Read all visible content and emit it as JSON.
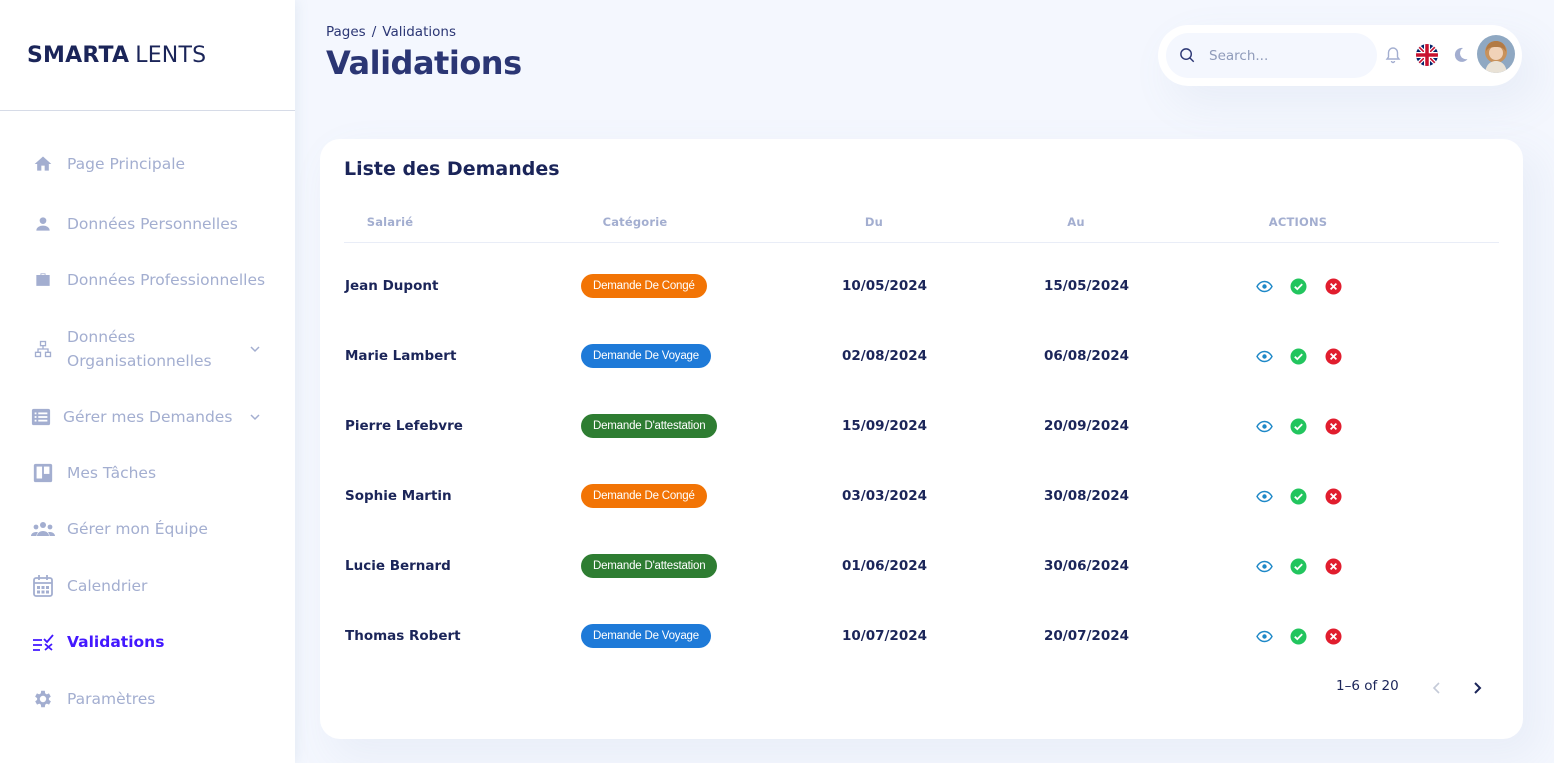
{
  "brand": {
    "bold": "SMARTA",
    "light": "LENTS"
  },
  "sidebar": {
    "items": [
      {
        "label": "Page Principale",
        "icon": "home-icon"
      },
      {
        "label": "Données Personnelles",
        "icon": "person-icon"
      },
      {
        "label": "Données Professionnelles",
        "icon": "briefcase-icon"
      },
      {
        "label": "Données Organisationnelles",
        "label_line1": "Données",
        "label_line2": "Organisationnelles",
        "icon": "org-chart-icon",
        "expandable": true
      },
      {
        "label": "Gérer mes Demandes",
        "icon": "list-icon",
        "expandable": true
      },
      {
        "label": "Mes Tâches",
        "icon": "board-icon"
      },
      {
        "label": "Gérer mon Équipe",
        "icon": "team-icon"
      },
      {
        "label": "Calendrier",
        "icon": "calendar-icon"
      },
      {
        "label": "Validations",
        "icon": "validations-icon",
        "active": true
      },
      {
        "label": "Paramètres",
        "icon": "gear-icon"
      }
    ]
  },
  "header": {
    "breadcrumb": {
      "root": "Pages",
      "separator": "/",
      "current": "Validations"
    },
    "title": "Validations"
  },
  "topbar": {
    "search_placeholder": "Search...",
    "language": "English (UK)"
  },
  "card": {
    "title": "Liste des Demandes",
    "columns": [
      "Salarié",
      "Catégorie",
      "Du",
      "Au",
      "ACTIONS"
    ],
    "rows": [
      {
        "name": "Jean Dupont",
        "category": "Demande De Congé",
        "category_color": "#f27405",
        "from": "10/05/2024",
        "to": "15/05/2024"
      },
      {
        "name": "Marie Lambert",
        "category": "Demande De Voyage",
        "category_color": "#1e7ad8",
        "from": "02/08/2024",
        "to": "06/08/2024"
      },
      {
        "name": "Pierre Lefebvre",
        "category": "Demande D'attestation",
        "category_color": "#2e7d32",
        "from": "15/09/2024",
        "to": "20/09/2024"
      },
      {
        "name": "Sophie Martin",
        "category": "Demande De Congé",
        "category_color": "#f27405",
        "from": "03/03/2024",
        "to": "30/08/2024"
      },
      {
        "name": "Lucie Bernard",
        "category": "Demande D'attestation",
        "category_color": "#2e7d32",
        "from": "01/06/2024",
        "to": "30/06/2024"
      },
      {
        "name": "Thomas Robert",
        "category": "Demande De Voyage",
        "category_color": "#1e7ad8",
        "from": "10/07/2024",
        "to": "20/07/2024"
      }
    ],
    "pagination": {
      "text": "1–6 of 20"
    }
  },
  "colors": {
    "accent": "#4318ff",
    "nav_inactive": "#a3aed0",
    "text_dark": "#1b2559",
    "approve": "#22c55e",
    "reject": "#e11d2e",
    "view": "#1e88c7",
    "background": "#f4f7fe"
  }
}
